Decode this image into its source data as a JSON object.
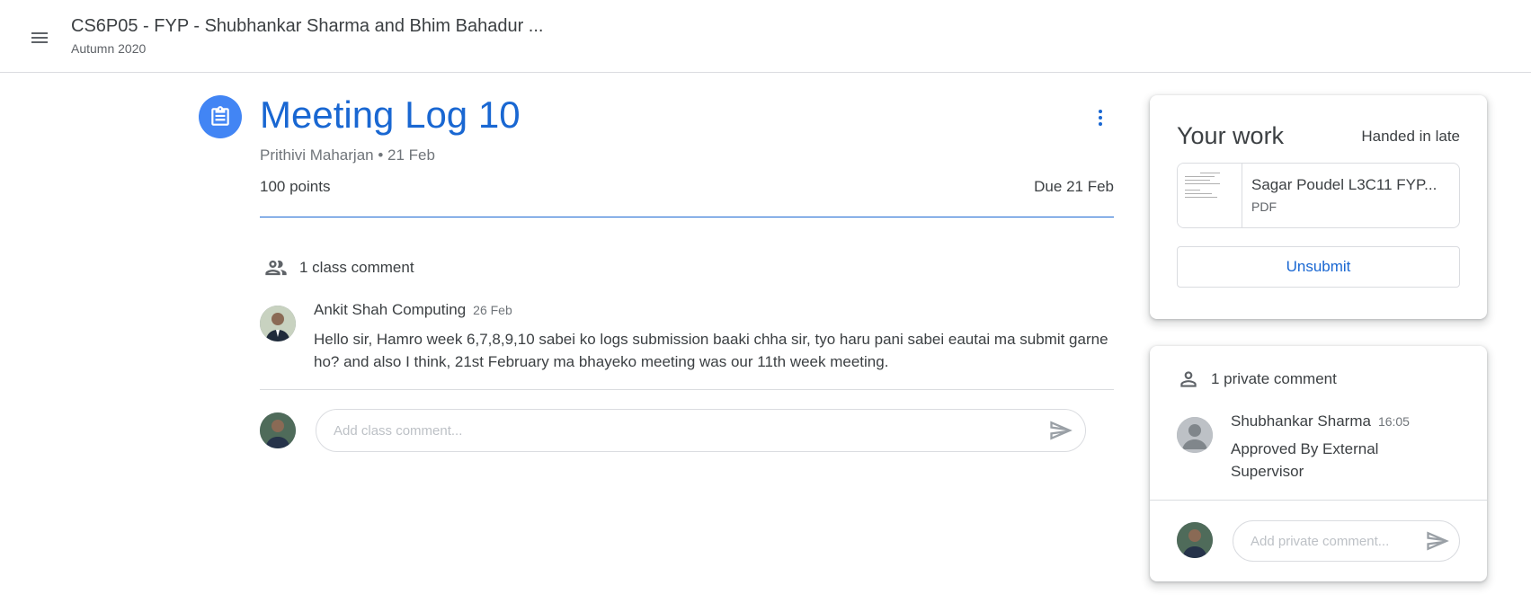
{
  "header": {
    "class_title": "CS6P05 - FYP - Shubhankar Sharma and Bhim Bahadur ...",
    "term": "Autumn 2020",
    "menu_icon": "menu-icon"
  },
  "assignment": {
    "title": "Meeting Log 10",
    "author_date": "Prithivi Maharjan • 21 Feb",
    "points": "100 points",
    "due": "Due 21 Feb",
    "icon": "assignment-icon",
    "accent": "#1967d2"
  },
  "class_comments": {
    "heading": "1 class comment",
    "icon": "people-icon",
    "items": [
      {
        "author": "Ankit Shah Computing",
        "time": "26 Feb",
        "text": "Hello sir, Hamro week 6,7,8,9,10 sabei ko logs submission baaki chha sir, tyo haru pani sabei eautai ma submit garne ho? and also I think, 21st February ma bhayeko meeting was our 11th week meeting."
      }
    ],
    "input_placeholder": "Add class comment..."
  },
  "your_work": {
    "title": "Your work",
    "status": "Handed in late",
    "attachment": {
      "name": "Sagar Poudel L3C11 FYP...",
      "type": "PDF"
    },
    "unsubmit_label": "Unsubmit"
  },
  "private_comments": {
    "heading": "1 private comment",
    "icon": "person-icon",
    "items": [
      {
        "author": "Shubhankar Sharma",
        "time": "16:05",
        "text": "Approved By External Supervisor"
      }
    ],
    "input_placeholder": "Add private comment..."
  }
}
